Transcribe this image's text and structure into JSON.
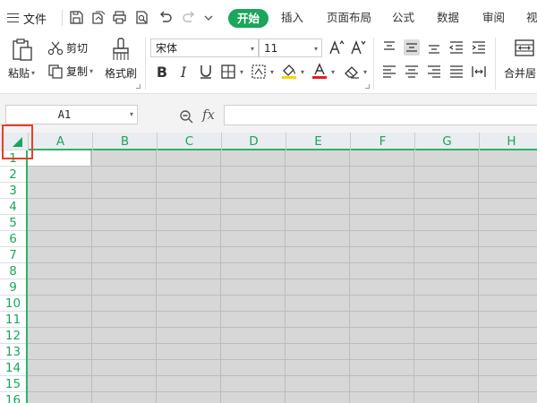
{
  "menubar": {
    "file_label": "文件",
    "tabs": [
      {
        "label": "开始",
        "active": true
      },
      {
        "label": "插入"
      },
      {
        "label": "页面布局"
      },
      {
        "label": "公式"
      },
      {
        "label": "数据"
      },
      {
        "label": "审阅"
      },
      {
        "label": "视"
      }
    ]
  },
  "ribbon": {
    "paste_label": "粘贴",
    "cut_label": "剪切",
    "copy_label": "复制",
    "format_painter_label": "格式刷",
    "font_name": "宋体",
    "font_size": "11",
    "merge_label": "合并居",
    "font_color": "#e02020",
    "fill_color": "#f5d400",
    "accent_color": "#1aa65c"
  },
  "formula_bar": {
    "name_box": "A1",
    "fx_label": "fx",
    "formula_value": ""
  },
  "sheet": {
    "columns": [
      "A",
      "B",
      "C",
      "D",
      "E",
      "F",
      "G",
      "H"
    ],
    "rows": [
      "1",
      "2",
      "3",
      "4",
      "5",
      "6",
      "7",
      "8",
      "9",
      "10",
      "11",
      "12",
      "13",
      "14",
      "15",
      "16"
    ],
    "header_color": "#1aa65c",
    "highlight_box_color": "#e8402a"
  }
}
